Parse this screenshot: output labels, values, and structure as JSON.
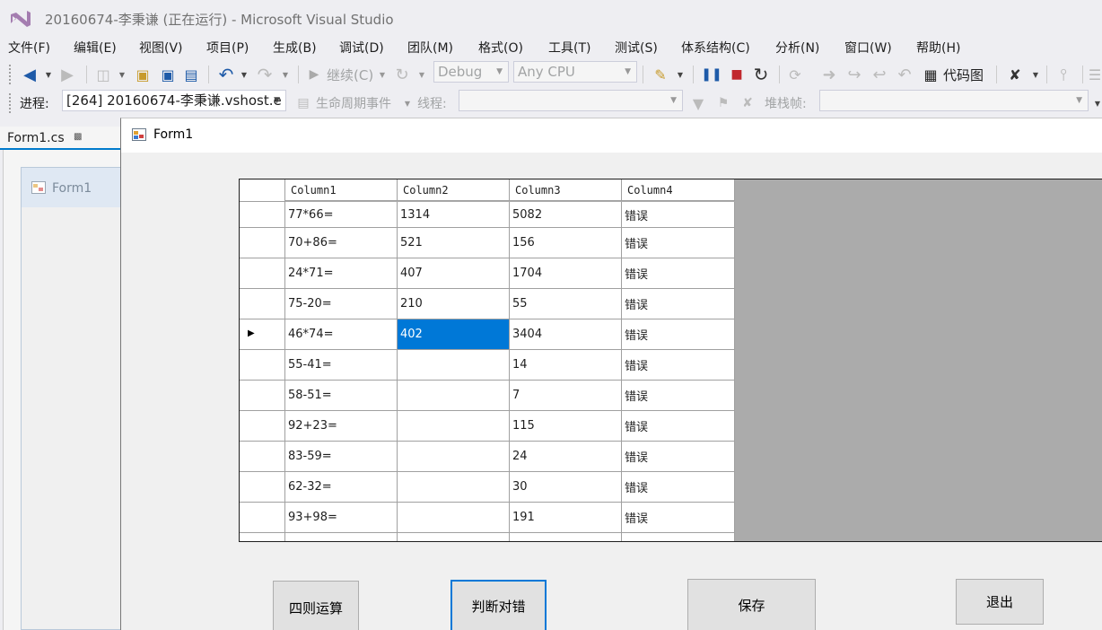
{
  "window": {
    "title": "20160674-李秉谦 (正在运行) - Microsoft Visual Studio"
  },
  "menu": [
    "文件(F)",
    "编辑(E)",
    "视图(V)",
    "项目(P)",
    "生成(B)",
    "调试(D)",
    "团队(M)",
    "格式(O)",
    "工具(T)",
    "测试(S)",
    "体系结构(C)",
    "分析(N)",
    "窗口(W)",
    "帮助(H)"
  ],
  "toolbar": {
    "continue_label": "继续(C)",
    "config_value": "Debug",
    "platform_value": "Any CPU",
    "codemap_label": "代码图"
  },
  "debug_bar": {
    "process_label": "进程:",
    "process_value": "[264] 20160674-李秉谦.vshost.e",
    "lifecycle_label": "生命周期事件",
    "thread_label": "线程:",
    "stackframe_label": "堆栈帧:"
  },
  "editor": {
    "doc_tab": "Form1.cs",
    "designer_form_title": "Form1"
  },
  "app": {
    "form_title": "Form1",
    "grid": {
      "columns": [
        "Column1",
        "Column2",
        "Column3",
        "Column4"
      ],
      "rows": [
        [
          "77*66=",
          "1314",
          "5082",
          "错误"
        ],
        [
          "70+86=",
          "521",
          "156",
          "错误"
        ],
        [
          "24*71=",
          "407",
          "1704",
          "错误"
        ],
        [
          "75-20=",
          "210",
          "55",
          "错误"
        ],
        [
          "46*74=",
          "402",
          "3404",
          "错误"
        ],
        [
          "55-41=",
          "",
          "14",
          "错误"
        ],
        [
          "58-51=",
          "",
          "7",
          "错误"
        ],
        [
          "92+23=",
          "",
          "115",
          "错误"
        ],
        [
          "83-59=",
          "",
          "24",
          "错误"
        ],
        [
          "62-32=",
          "",
          "30",
          "错误"
        ],
        [
          "93+98=",
          "",
          "191",
          "错误"
        ]
      ],
      "current_row": 4,
      "selected_cell": "402"
    },
    "buttons": {
      "arith": "四则运算",
      "judge": "判断对错",
      "save": "保存",
      "exit": "退出"
    }
  }
}
